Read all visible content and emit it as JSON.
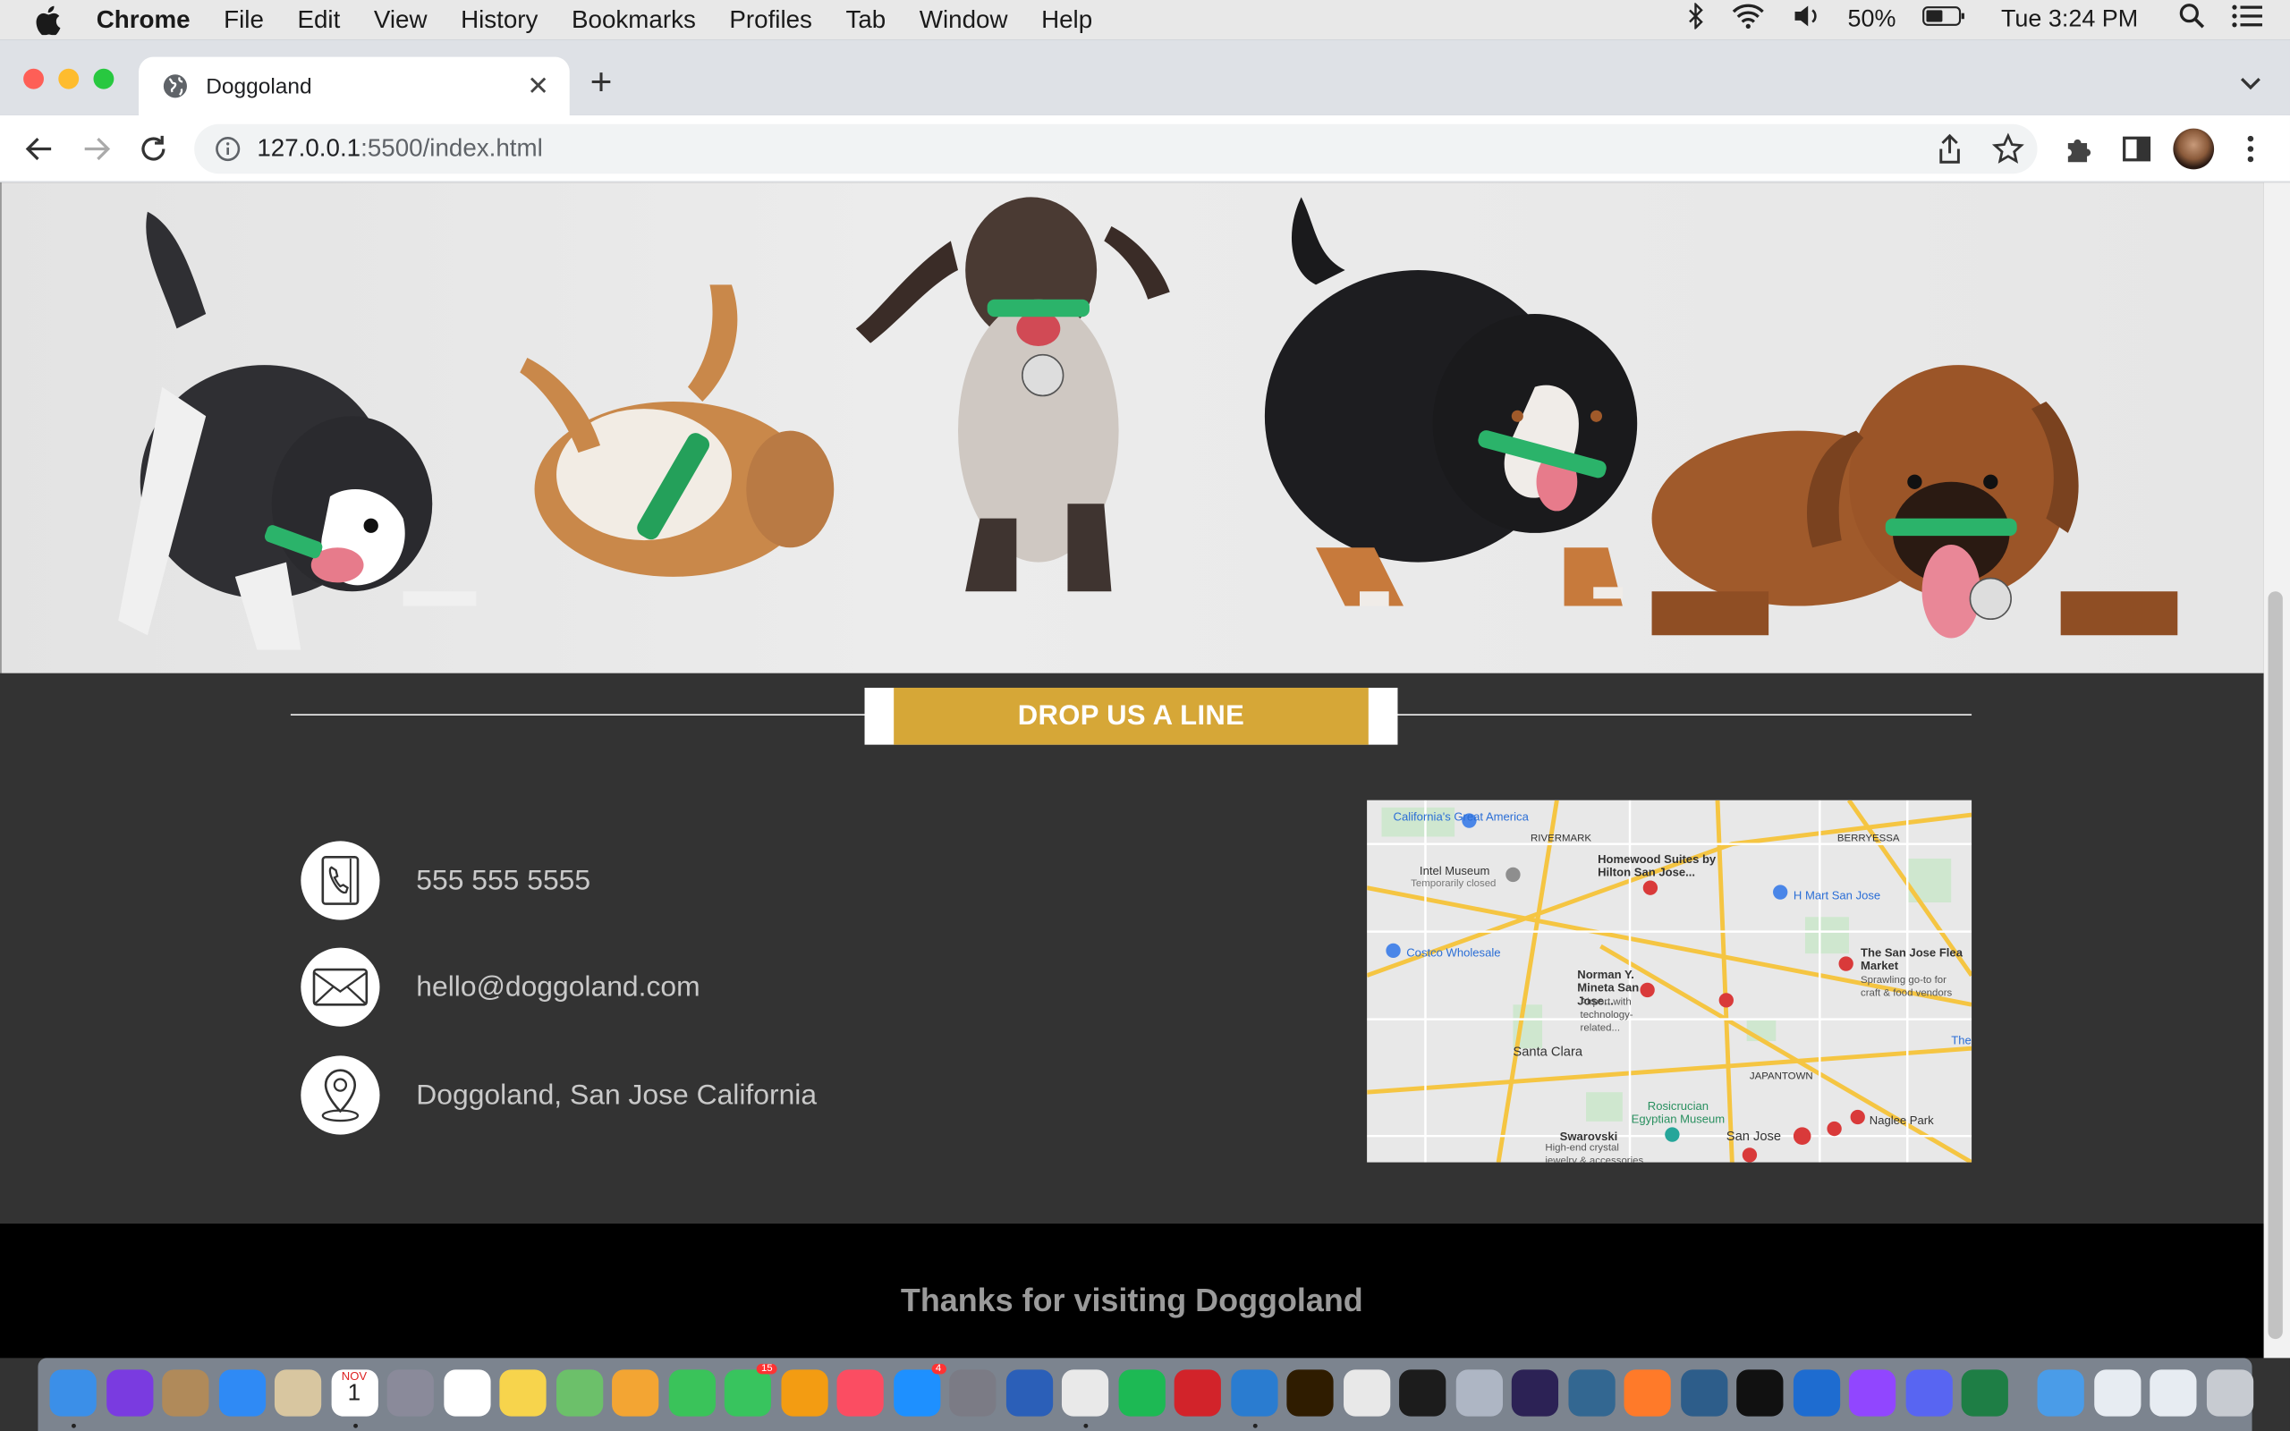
{
  "menubar": {
    "app": "Chrome",
    "items": [
      "File",
      "Edit",
      "View",
      "History",
      "Bookmarks",
      "Profiles",
      "Tab",
      "Window",
      "Help"
    ],
    "battery": "50%",
    "clock": "Tue 3:24 PM"
  },
  "browser": {
    "tab_title": "Doggoland",
    "url_host": "127.0.0.1",
    "url_path": ":5500/index.html"
  },
  "page": {
    "section_heading": "DROP US A LINE",
    "contacts": {
      "phone": "555 555 5555",
      "email": "hello@doggoland.com",
      "address": "Doggoland, San Jose California"
    },
    "map_labels": {
      "great_america": "California's Great America",
      "rivermark": "RIVERMARK",
      "berryessa": "BERRYESSA",
      "homewood": "Homewood Suites by Hilton San Jose...",
      "intel": "Intel Museum",
      "intel_sub": "Temporarily closed",
      "hmart": "H Mart San Jose",
      "costco": "Costco Wholesale",
      "flea": "The San Jose Flea Market",
      "flea_sub": "Sprawling go-to for craft & food vendors",
      "mineta": "Norman Y. Mineta San Jose...",
      "mineta_sub": "Airport with technology-related...",
      "santa_clara": "Santa Clara",
      "japantown": "JAPANTOWN",
      "rosicrucian": "Rosicrucian Egyptian Museum",
      "swarovski": "Swarovski",
      "swarovski_sub": "High-end crystal jewelry & accessories",
      "san_jose": "San Jose",
      "naglee": "Naglee Park",
      "the": "The"
    },
    "footer_text": "Thanks for visiting Doggoland"
  },
  "dock": {
    "apps": [
      "finder",
      "siri",
      "notefile",
      "safari",
      "preview",
      "calendar",
      "launchpad",
      "reminders",
      "notes",
      "maps",
      "photos",
      "messages",
      "facetime",
      "books",
      "music",
      "app-store",
      "system-preferences",
      "word",
      "chrome",
      "spotify",
      "acrobat",
      "vscode",
      "illustrator",
      "textedit",
      "terminal",
      "utility",
      "eclipse",
      "postgres",
      "sublime",
      "mysql",
      "intellij",
      "sourcetree",
      "twitch",
      "discord",
      "excel",
      "downloads",
      "screenshot",
      "screenshot-2",
      "trash"
    ],
    "badges": {
      "facetime": "15",
      "app-store": "4"
    },
    "calendar_month": "NOV",
    "calendar_day": "1"
  }
}
